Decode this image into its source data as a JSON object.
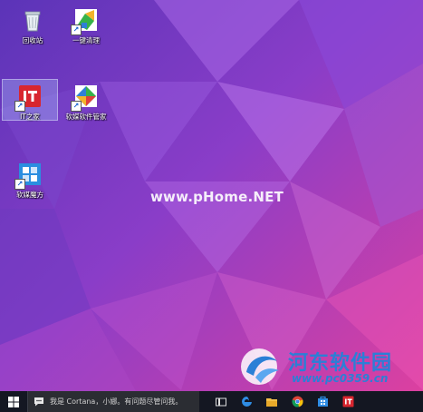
{
  "desktop": {
    "icons": [
      {
        "label": "回收站",
        "name": "recycle-bin"
      },
      {
        "label": "一键清理",
        "name": "one-click-cleanup"
      },
      {
        "label": "IT之家",
        "name": "ithome"
      },
      {
        "label": "软媒软件管家",
        "name": "ruanmei-software-manager"
      },
      {
        "label": "软媒魔方",
        "name": "ruanmei-mofang"
      }
    ]
  },
  "watermark": {
    "text": "www.pHome.NET"
  },
  "branding": {
    "name": "河东软件园",
    "url": "www.pc0359.cn"
  },
  "taskbar": {
    "search_placeholder": "我是 Cortana，小娜。有问题尽管问我。",
    "pinned": [
      "task-view",
      "edge",
      "file-explorer",
      "chrome",
      "store",
      "ithome"
    ]
  },
  "colors": {
    "wallpaper_purple": "#7b3fc4",
    "wallpaper_pink": "#e23fa8",
    "taskbar": "#141722",
    "accent_blue": "#2b7fd6"
  }
}
